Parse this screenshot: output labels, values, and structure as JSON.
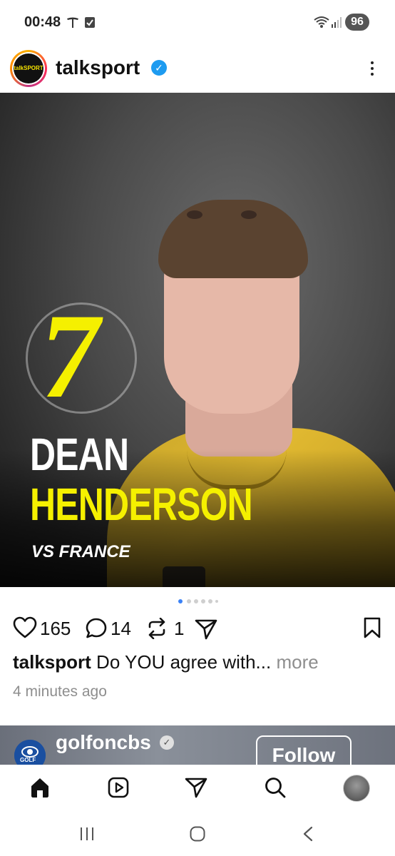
{
  "status_bar": {
    "time": "00:48",
    "battery": "96"
  },
  "post": {
    "username": "talkSPORT",
    "account": "talksport",
    "image": {
      "number": "7",
      "first_name": "DEAN",
      "last_name": "HENDERSON",
      "subtitle": "VS FRANCE"
    },
    "likes": "165",
    "comments": "14",
    "reposts": "1",
    "caption_user": "talksport",
    "caption_text": " Do YOU agree with...",
    "caption_more": " more",
    "time_ago": "4 minutes ago"
  },
  "next_post": {
    "avatar_text": "GOLF",
    "username": "golfoncbs",
    "follow_label": "Follow"
  },
  "colors": {
    "accent_yellow": "#f5f000",
    "verified_blue": "#1d9bf0"
  }
}
